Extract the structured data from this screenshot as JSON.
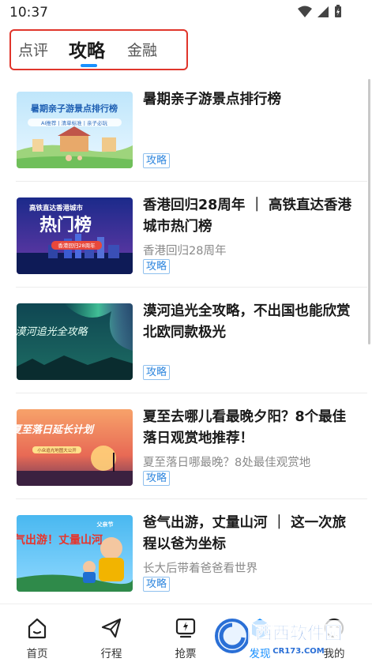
{
  "status_bar": {
    "time": "10:37"
  },
  "tabs": [
    {
      "label": "点评"
    },
    {
      "label": "攻略"
    },
    {
      "label": "金融"
    }
  ],
  "articles": [
    {
      "title": "暑期亲子游景点排行榜",
      "subtitle": "",
      "tag": "攻略",
      "thumb_title": "暑期亲子游景点排行榜",
      "thumb_sub": "AI推荐 | 清单标准 | 亲子必玩"
    },
    {
      "title": "香港回归28周年 ｜ 高铁直达香港城市热门榜",
      "subtitle": "香港回归28周年",
      "tag": "攻略",
      "thumb_title": "热门榜",
      "thumb_sub": "高铁直达香港城市",
      "thumb_badge": "香港回归28周年"
    },
    {
      "title": "漠河追光全攻略，不出国也能欣赏北欧同款极光",
      "subtitle": "",
      "tag": "攻略",
      "thumb_title": "漠河追光全攻略"
    },
    {
      "title": "夏至去哪儿看最晚夕阳？8个最佳落日观赏地推荐！",
      "subtitle": "夏至落日哪最晚？8处最佳观赏地",
      "tag": "攻略",
      "thumb_title": "夏至落日延长计划",
      "thumb_sub": "小众追光地图大公开"
    },
    {
      "title": "爸气出游，丈量山河 ｜ 这一次旅程以爸为坐标",
      "subtitle": "长大后带着爸爸看世界",
      "tag": "攻略",
      "thumb_title": "爸气出游！丈量山河",
      "thumb_sub": "父亲节"
    }
  ],
  "bottom_nav": [
    {
      "label": "首页",
      "icon": "home-icon"
    },
    {
      "label": "行程",
      "icon": "send-icon"
    },
    {
      "label": "抢票",
      "icon": "ticket-icon"
    },
    {
      "label": "发现",
      "icon": "discover-icon"
    },
    {
      "label": "我的",
      "icon": "profile-icon"
    }
  ],
  "watermark": {
    "text": "西西软件园",
    "sub": "CR173.COM"
  },
  "colors": {
    "accent": "#1890ff",
    "highlight_border": "#e0352b",
    "tag": "#2e86de"
  }
}
